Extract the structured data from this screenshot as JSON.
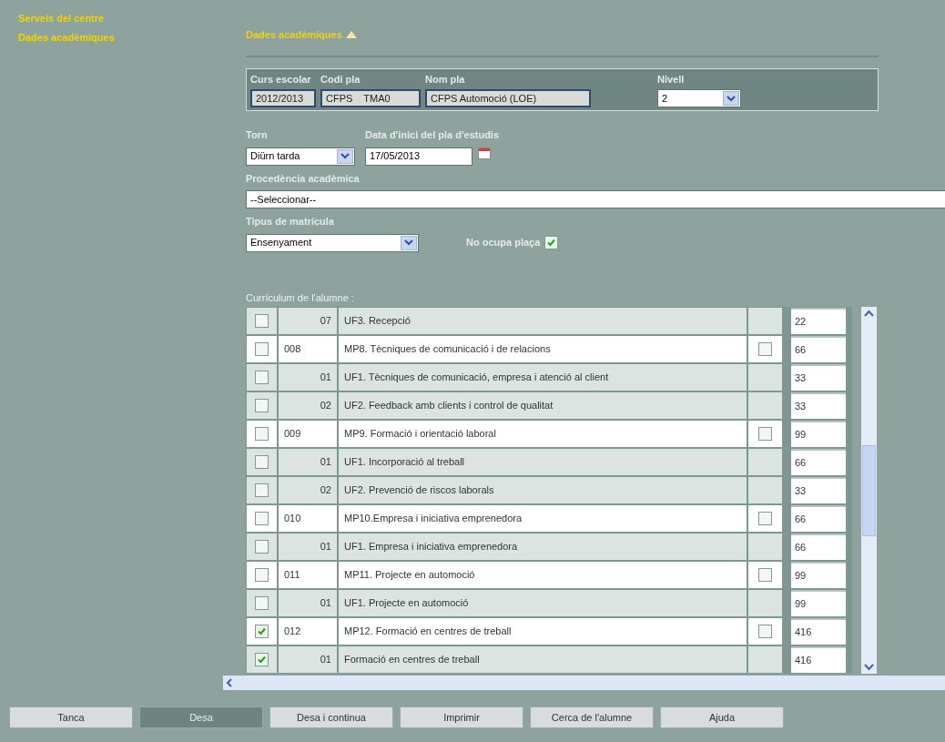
{
  "sidebar": {
    "items": [
      {
        "label": "Serveis del centre"
      },
      {
        "label": "Dades acadèmiques"
      }
    ]
  },
  "section": {
    "title": "Dades acadèmiques",
    "expanded": true
  },
  "plan": {
    "fields": [
      {
        "label": "Curs escolar",
        "value": "2012/2013",
        "kind": "text"
      },
      {
        "label": "Codi pla",
        "value": "CFPS    TMA0",
        "kind": "text"
      },
      {
        "label": "Nom pla",
        "value": "CFPS Automoció (LOE)",
        "kind": "text"
      },
      {
        "label": "Nivell",
        "value": "2",
        "kind": "select"
      }
    ]
  },
  "torn": {
    "label": "Torn",
    "value": "Diürn tarda"
  },
  "start_date": {
    "label": "Data d'inici del pla d'estudis",
    "value": "17/05/2013"
  },
  "origin": {
    "label": "Procedència acadèmica",
    "value": "--Seleccionar--"
  },
  "enrolment": {
    "label": "Tipus de matrícula",
    "value": "Ensenyament"
  },
  "no_place": {
    "label": "No ocupa plaça",
    "checked": true
  },
  "curriculum": {
    "title": "Currículum de l'alumne :",
    "rows": [
      {
        "kind": "unit",
        "checked": false,
        "code": "07",
        "name": "UF3. Recepció",
        "hours": "22"
      },
      {
        "kind": "module",
        "checked": false,
        "code": "008",
        "name": "MP8. Tècniques de comunicació i de relacions",
        "exempt": false,
        "hours": "66"
      },
      {
        "kind": "unit",
        "checked": false,
        "code": "01",
        "name": "UF1. Tècniques de comunicació, empresa i atenció al client",
        "hours": "33"
      },
      {
        "kind": "unit",
        "checked": false,
        "code": "02",
        "name": "UF2. Feedback amb clients i control de qualitat",
        "hours": "33"
      },
      {
        "kind": "module",
        "checked": false,
        "code": "009",
        "name": "MP9. Formació i orientació laboral",
        "exempt": false,
        "hours": "99"
      },
      {
        "kind": "unit",
        "checked": false,
        "code": "01",
        "name": "UF1. Incorporació al treball",
        "hours": "66"
      },
      {
        "kind": "unit",
        "checked": false,
        "code": "02",
        "name": "UF2. Prevenció de riscos laborals",
        "hours": "33"
      },
      {
        "kind": "module",
        "checked": false,
        "code": "010",
        "name": "MP10.Empresa i iniciativa emprenedora",
        "exempt": false,
        "hours": "66"
      },
      {
        "kind": "unit",
        "checked": false,
        "code": "01",
        "name": "UF1. Empresa i iniciativa emprenedora",
        "hours": "66"
      },
      {
        "kind": "module",
        "checked": false,
        "code": "011",
        "name": "MP11. Projecte en automoció",
        "exempt": false,
        "hours": "99"
      },
      {
        "kind": "unit",
        "checked": false,
        "code": "01",
        "name": "UF1. Projecte en automoció",
        "hours": "99"
      },
      {
        "kind": "module",
        "checked": true,
        "code": "012",
        "name": "MP12. Formació en centres de treball",
        "exempt": false,
        "hours": "416"
      },
      {
        "kind": "unit",
        "checked": true,
        "code": "01",
        "name": "Formació en centres de treball",
        "hours": "416"
      }
    ]
  },
  "buttons": [
    {
      "label": "Tanca",
      "selected": false
    },
    {
      "label": "Desa",
      "selected": true
    },
    {
      "label": "Desa i continua",
      "selected": false
    },
    {
      "label": "Imprimir",
      "selected": false
    },
    {
      "label": "Cerca de l'alumne",
      "selected": false
    },
    {
      "label": "Ajuda",
      "selected": false
    }
  ]
}
